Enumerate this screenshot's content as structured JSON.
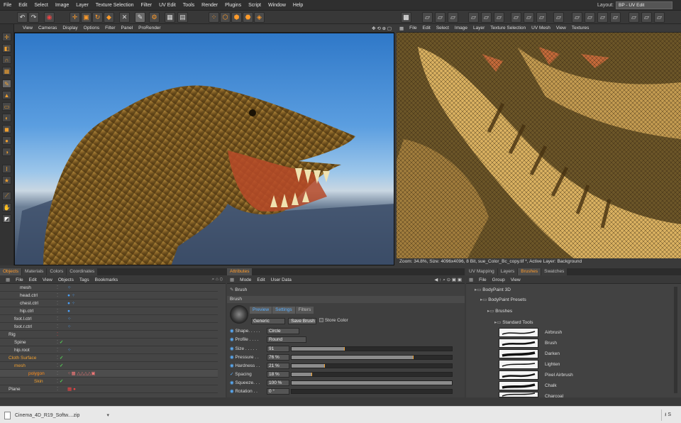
{
  "menubar": {
    "items": [
      "File",
      "Edit",
      "Select",
      "Image",
      "Layer",
      "Texture Selection",
      "Filter",
      "UV Edit",
      "Tools",
      "Render",
      "Plugins",
      "Script",
      "Window",
      "Help"
    ],
    "layout_label": "Layout:",
    "layout_value": "BP - UV Edit"
  },
  "viewport3d": {
    "menu": [
      "View",
      "Cameras",
      "Display",
      "Options",
      "Filter",
      "Panel",
      "ProRender"
    ]
  },
  "uvview": {
    "menu": [
      "File",
      "Edit",
      "Select",
      "Image",
      "Layer",
      "Texture Selection",
      "UV Mesh",
      "View",
      "Textures"
    ],
    "status": "Zoom: 34.8%, Size: 4096x4096, 8 Bit, sue_Color_Bc_copy.tif *, Active Layer: Background"
  },
  "objects": {
    "tabs": [
      "Objects",
      "Materials",
      "Colors",
      "Coordinates"
    ],
    "menu": [
      "File",
      "Edit",
      "View",
      "Objects",
      "Tags",
      "Bookmarks"
    ],
    "rows": [
      {
        "name": "mesh",
        "indent": 2
      },
      {
        "name": "head.ctrl",
        "indent": 2
      },
      {
        "name": "chest.ctrl",
        "indent": 2
      },
      {
        "name": "hip.ctrl",
        "indent": 2
      },
      {
        "name": "foot.l.ctrl",
        "indent": 1
      },
      {
        "name": "foot.r.ctrl",
        "indent": 1
      },
      {
        "name": "Rig",
        "indent": 0
      },
      {
        "name": "Spine",
        "indent": 1
      },
      {
        "name": "hip.root",
        "indent": 1
      },
      {
        "name": "Cloth Surface",
        "indent": 0
      },
      {
        "name": "mesh",
        "indent": 1
      },
      {
        "name": "polygon",
        "indent": 2
      },
      {
        "name": "Skin",
        "indent": 3
      },
      {
        "name": "Plane",
        "indent": 0
      }
    ]
  },
  "attributes": {
    "tabs": [
      "Attributes"
    ],
    "menu": [
      "Mode",
      "Edit",
      "User Data"
    ],
    "title": "Brush",
    "section": "Brush",
    "subtabs": [
      "Preview",
      "Settings",
      "Filters"
    ],
    "preset": "Generic",
    "save_btn": "Save Brush",
    "store_color": "Store Color",
    "shape_label": "Shape. . . . .",
    "shape_value": "Circle",
    "profile_label": "Profile . . . .",
    "profile_value": "Round",
    "params": [
      {
        "label": "Size . . . . .",
        "value": "91",
        "fill": 0.33
      },
      {
        "label": "Pressure . .",
        "value": "76 %",
        "fill": 0.76
      },
      {
        "label": "Hardness . .",
        "value": "21 %",
        "fill": 0.21
      },
      {
        "label": "Spacing",
        "value": "18 %",
        "fill": 0.13
      },
      {
        "label": "Squeeze. . .",
        "value": "100 %",
        "fill": 1.0
      },
      {
        "label": "Rotation . .",
        "value": "0 °",
        "fill": 0.0
      }
    ]
  },
  "brushes": {
    "tabs": [
      "UV Mapping",
      "Layers",
      "Brushes",
      "Swatches"
    ],
    "menu": [
      "File",
      "Group",
      "View"
    ],
    "tree": [
      "BodyPaint 3D",
      "BodyPaint Presets",
      "Brushes",
      "Standard Tools"
    ],
    "items": [
      "Airbrush",
      "Brush",
      "Darken",
      "Lighten",
      "Pixel Airbrush",
      "Chalk",
      "Charcoal"
    ]
  },
  "download": {
    "file": "Cinema_4D_R19_Softw....zip",
    "show_all": "S"
  }
}
